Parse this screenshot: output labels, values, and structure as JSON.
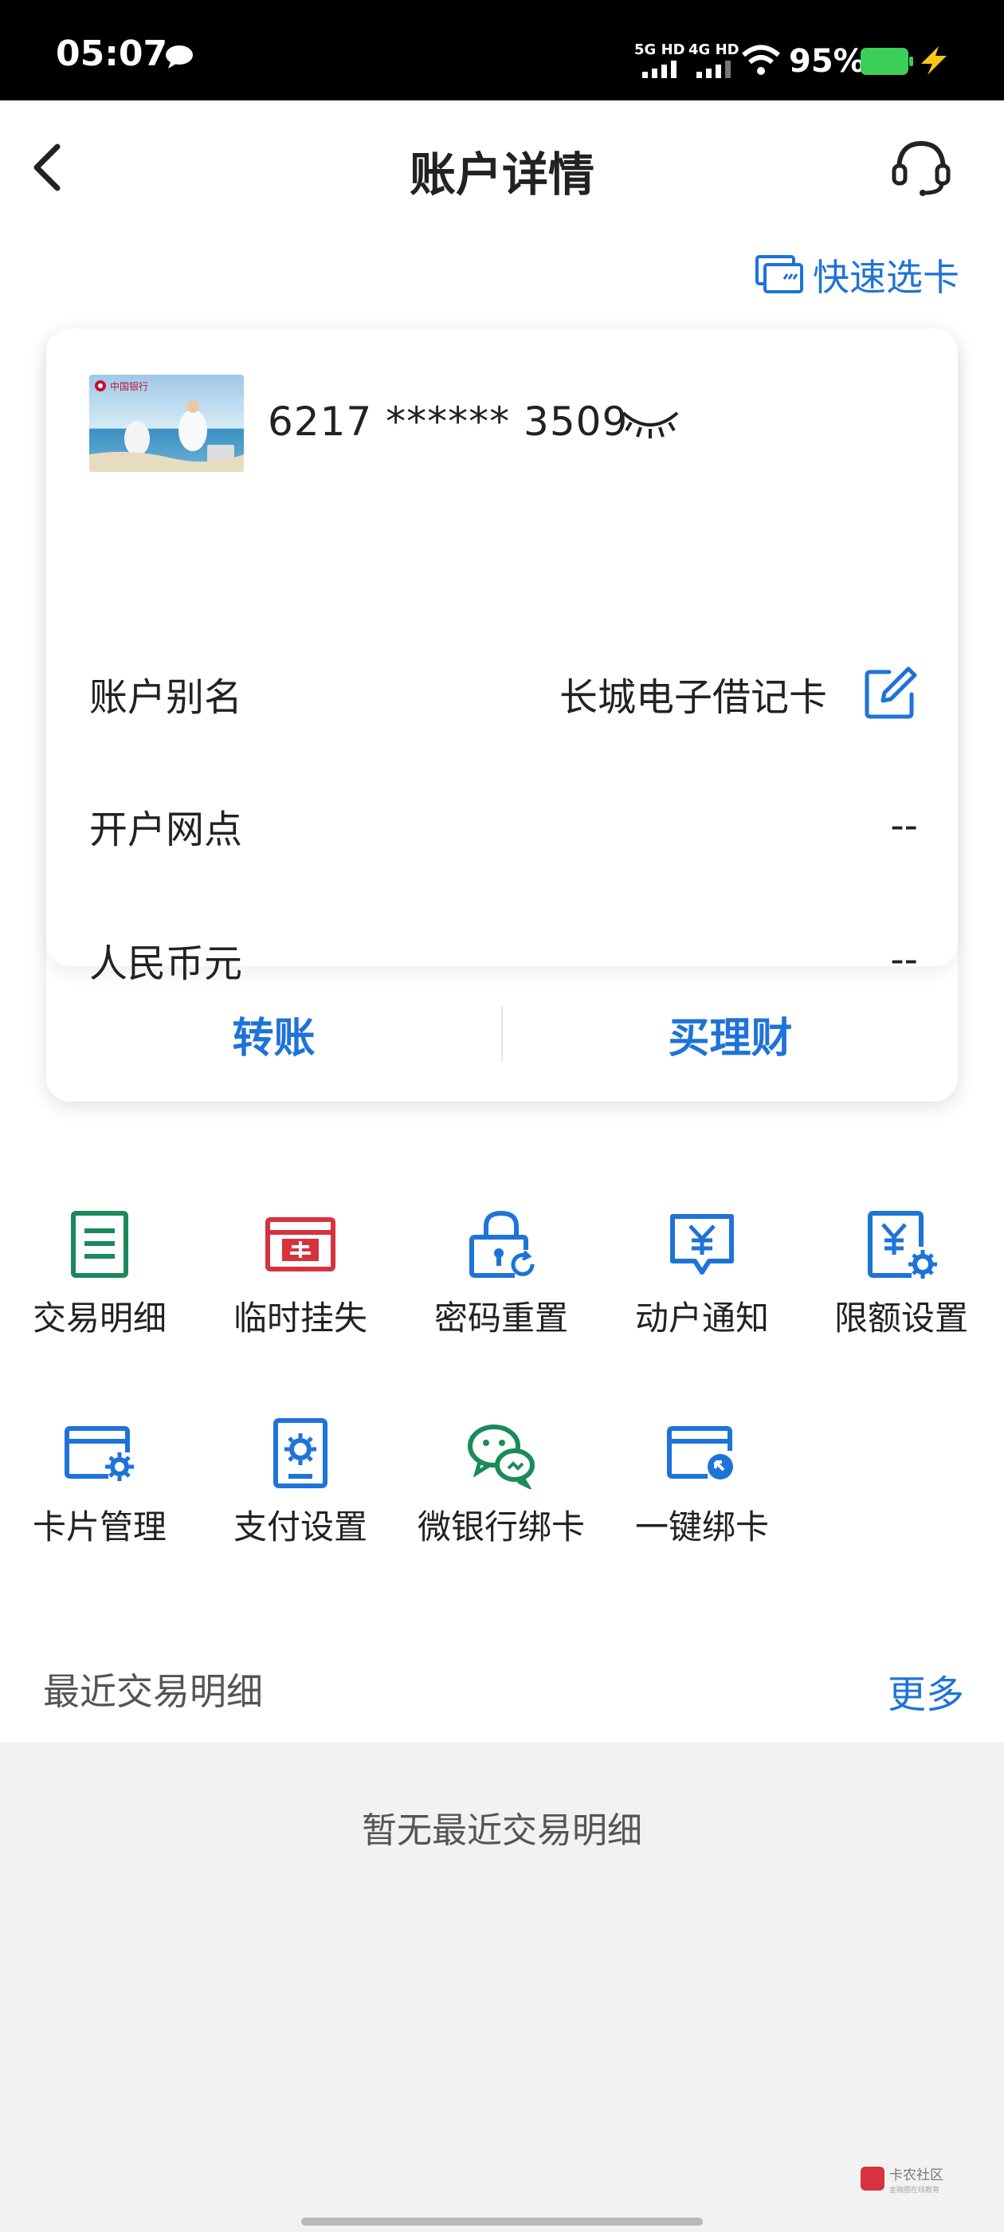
{
  "status_bar": {
    "time": "05:07",
    "network_1": "5G HD",
    "network_2": "4G HD",
    "battery": "95%"
  },
  "header": {
    "title": "账户详情",
    "back_icon": "chevron-left-icon",
    "support_icon": "headset-icon"
  },
  "quick_select": {
    "label": "快速选卡",
    "icon": "card-stack-icon"
  },
  "account": {
    "card_number": "6217 ****** 3509",
    "visibility_icon": "eye-closed-icon",
    "bank_logo_text": "中国银行",
    "rows": [
      {
        "label": "账户别名",
        "value": "长城电子借记卡"
      },
      {
        "label": "开户网点",
        "value": "--"
      },
      {
        "label": "人民币元",
        "value": "--"
      }
    ],
    "actions": {
      "transfer": "转账",
      "wealth": "买理财"
    }
  },
  "services": [
    {
      "label": "交易明细",
      "icon": "transaction-list-icon"
    },
    {
      "label": "临时挂失",
      "icon": "report-loss-icon"
    },
    {
      "label": "密码重置",
      "icon": "lock-reset-icon"
    },
    {
      "label": "动户通知",
      "icon": "account-notice-icon"
    },
    {
      "label": "限额设置",
      "icon": "limit-settings-icon"
    },
    {
      "label": "卡片管理",
      "icon": "card-manage-icon"
    },
    {
      "label": "支付设置",
      "icon": "payment-settings-icon"
    },
    {
      "label": "微银行绑卡",
      "icon": "wechat-bind-icon"
    },
    {
      "label": "一键绑卡",
      "icon": "one-click-bind-icon"
    }
  ],
  "recent": {
    "title": "最近交易明细",
    "more": "更多",
    "empty": "暂无最近交易明细"
  },
  "watermark": {
    "text": "卡农社区",
    "sub": "金融圈在线教育"
  },
  "colors": {
    "accent": "#1e73d8",
    "green": "#1a8a5a",
    "red": "#d6333f"
  }
}
